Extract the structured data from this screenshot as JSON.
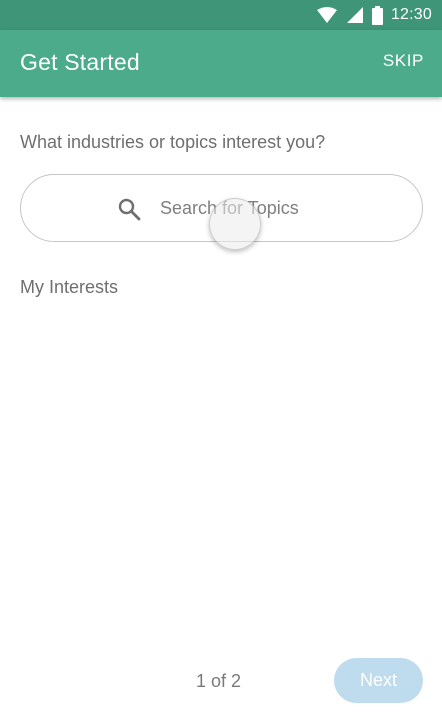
{
  "status_bar": {
    "time": "12:30",
    "icons": [
      "wifi-icon",
      "signal-icon",
      "battery-icon"
    ],
    "background": "#3e9577"
  },
  "app_bar": {
    "title": "Get Started",
    "skip_label": "SKIP",
    "background": "#4bab8b"
  },
  "main": {
    "prompt": "What industries or topics interest you?",
    "search": {
      "placeholder": "Search for Topics",
      "icon": "search-icon"
    },
    "interests_label": "My Interests"
  },
  "footer": {
    "page_indicator": "1 of 2",
    "next_label": "Next",
    "next_color": "#bfdcee"
  }
}
